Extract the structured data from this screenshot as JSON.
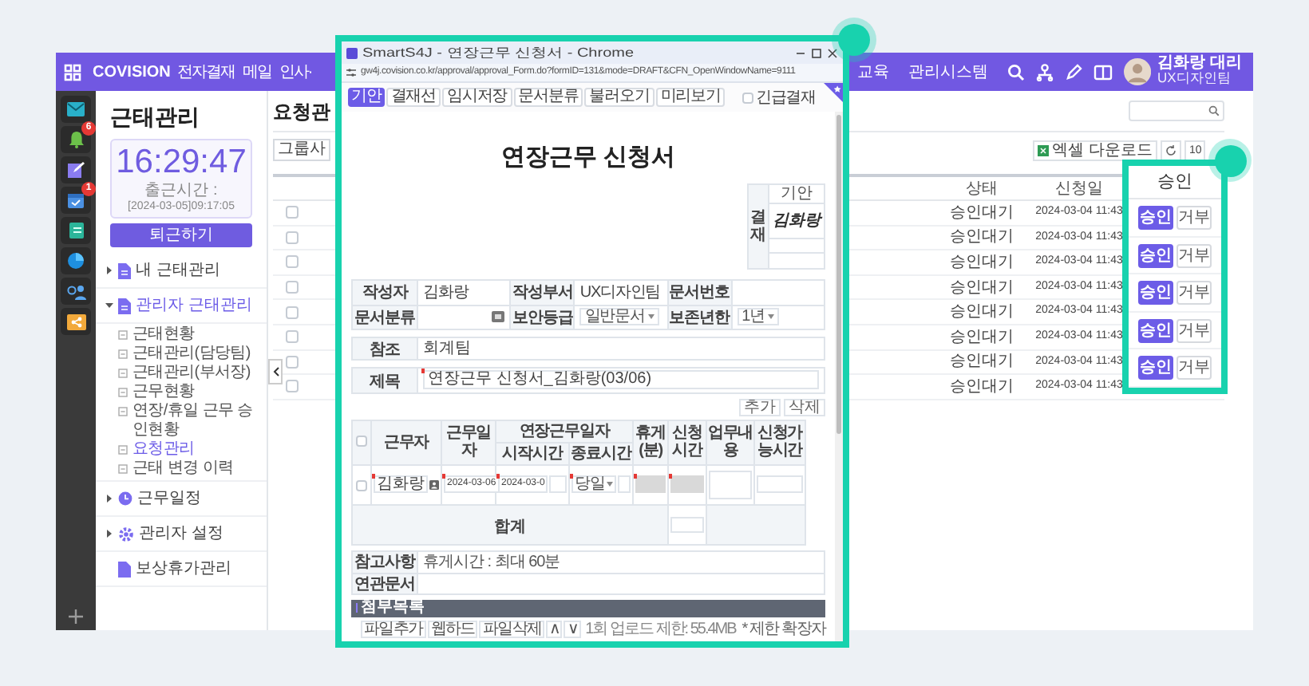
{
  "app": {
    "logo": "COVISION",
    "nav": [
      {
        "label": "전자결재"
      },
      {
        "label": "메일"
      },
      {
        "label": "인사·"
      }
    ],
    "nav_right": [
      {
        "label": "교육"
      },
      {
        "label": "관리시스템"
      }
    ],
    "user": {
      "name": "김화랑 대리",
      "dept": "UX디자인팀"
    }
  },
  "rail": {
    "items": [
      {
        "kind": "mail"
      },
      {
        "kind": "bell",
        "badge": "6"
      },
      {
        "kind": "note"
      },
      {
        "kind": "calendar",
        "badge": "1"
      },
      {
        "kind": "notebook"
      },
      {
        "kind": "chart"
      },
      {
        "kind": "contacts"
      },
      {
        "kind": "share"
      }
    ]
  },
  "sidebar": {
    "title": "근태관리",
    "clock": {
      "time": "16:29:47",
      "checkin_label": "출근시간 :",
      "checkin_time": "[2024-03-05]09:17:05"
    },
    "button": "퇴근하기",
    "tree": [
      {
        "label": "내 근태관리",
        "expanded": false,
        "selected": false
      },
      {
        "label": "관리자 근태관리",
        "expanded": true,
        "selected": true,
        "children": [
          {
            "label": "근태현황",
            "selected": false
          },
          {
            "label": "근태관리(담당팀)",
            "selected": false
          },
          {
            "label": "근태관리(부서장)",
            "selected": false
          },
          {
            "label": "근무현황",
            "selected": false
          },
          {
            "label": "연장/휴일 근무 승인현황",
            "selected": false
          },
          {
            "label": "요청관리",
            "selected": true
          },
          {
            "label": "근태 변경 이력",
            "selected": false
          }
        ]
      },
      {
        "label": "근무일정",
        "expanded": false,
        "selected": false
      },
      {
        "label": "관리자 설정",
        "expanded": false,
        "selected": false
      },
      {
        "label": "보상휴가관리",
        "selected": false
      }
    ]
  },
  "content": {
    "title": "요청관",
    "group_select": "그룹사",
    "excel_button": "엑셀 다운로드",
    "page_size": "10",
    "table": {
      "columns": [
        "상태",
        "신청일"
      ],
      "rows": [
        {
          "checked": false,
          "status": "승인대기",
          "date": "2024-03-04 11:43"
        },
        {
          "checked": false,
          "status": "승인대기",
          "date": "2024-03-04 11:43"
        },
        {
          "checked": false,
          "status": "승인대기",
          "date": "2024-03-04 11:43"
        },
        {
          "checked": false,
          "status": "승인대기",
          "date": "2024-03-04 11:43"
        },
        {
          "checked": false,
          "status": "승인대기",
          "date": "2024-03-04 11:43"
        },
        {
          "checked": false,
          "status": "승인대기",
          "date": "2024-03-04 11:43"
        },
        {
          "checked": false,
          "status": "승인대기",
          "date": "2024-03-04 11:43"
        },
        {
          "checked": false,
          "status": "승인대기",
          "date": "2024-03-04 11:43"
        }
      ]
    }
  },
  "callout": {
    "header": "승인",
    "rows": [
      {
        "approve": "승인",
        "reject": "거부"
      },
      {
        "approve": "승인",
        "reject": "거부"
      },
      {
        "approve": "승인",
        "reject": "거부"
      },
      {
        "approve": "승인",
        "reject": "거부"
      },
      {
        "approve": "승인",
        "reject": "거부"
      }
    ]
  },
  "popup": {
    "title": "SmartS4J - 연장근무 신청서 - Chrome",
    "url": "gw4j.covision.co.kr/approval/approval_Form.do?formID=131&mode=DRAFT&CFN_OpenWindowName=9111",
    "toolbar": [
      {
        "label": "기안",
        "selected": true
      },
      {
        "label": "결재선",
        "selected": false
      },
      {
        "label": "임시저장",
        "selected": false
      },
      {
        "label": "문서분류",
        "selected": false
      },
      {
        "label": "불러오기",
        "selected": false
      },
      {
        "label": "미리보기",
        "selected": false
      }
    ],
    "urgent": {
      "label": "긴급결재",
      "checked": false
    },
    "form": {
      "title": "연장근무 신청서",
      "approval": {
        "label": "결재",
        "step": "기안",
        "signer": "김화랑"
      },
      "info": [
        [
          {
            "label": "작성자",
            "value": "김화랑",
            "kind": "text"
          },
          {
            "label": "작성부서",
            "value": "UX디자인팀",
            "kind": "text"
          },
          {
            "label": "문서번호",
            "kind": "text"
          }
        ],
        [
          {
            "label": "문서분류",
            "kind": "picker"
          },
          {
            "label": "보안등급",
            "value": "일반문서",
            "kind": "select"
          },
          {
            "label": "보존년한",
            "value": "1년",
            "kind": "select"
          }
        ]
      ],
      "reference": {
        "label": "참조",
        "value": "회계팀"
      },
      "subject": {
        "label": "제목",
        "value": "연장근무 신청서_김화랑(03/06)",
        "required": true
      },
      "add": "추가",
      "delete": "삭제",
      "work": {
        "select_all": {
          "checked": false
        },
        "columns": [
          {
            "label": "근무자"
          },
          {
            "label": "근무일자"
          },
          {
            "label": "연장근무일자",
            "children": [
              {
                "label": "시작시간"
              },
              {
                "label": "종료시간"
              }
            ]
          },
          {
            "label": "휴게(분)"
          },
          {
            "label": "신청시간"
          },
          {
            "label": "업무내용"
          },
          {
            "label": "신청가능시간"
          }
        ],
        "row": {
          "checked": false,
          "cells": [
            {
              "kind": "person",
              "value": "김화랑",
              "required": true
            },
            {
              "kind": "input",
              "value": "2024-03-06",
              "required": true
            },
            {
              "kind": "datetime",
              "value": "2024-03-0",
              "required": true
            },
            {
              "kind": "select",
              "value": "당일",
              "required": true
            },
            {
              "kind": "readonly",
              "required": true
            },
            {
              "kind": "readonly",
              "required": true
            },
            {
              "kind": "textarea",
              "required": false
            },
            {
              "kind": "input",
              "required": false
            }
          ]
        },
        "total": "합계"
      },
      "notes": [
        {
          "label": "참고사항",
          "value": "휴게시간 : 최대 60분"
        },
        {
          "label": "연관문서"
        }
      ],
      "attach": {
        "title": "첨부목록",
        "buttons": [
          "파일추가",
          "웹하드",
          "파일삭제",
          "∧",
          "∨"
        ],
        "limit": "1회 업로드 제한: 55.4MB",
        "note": "* 제한 확장자"
      }
    }
  }
}
